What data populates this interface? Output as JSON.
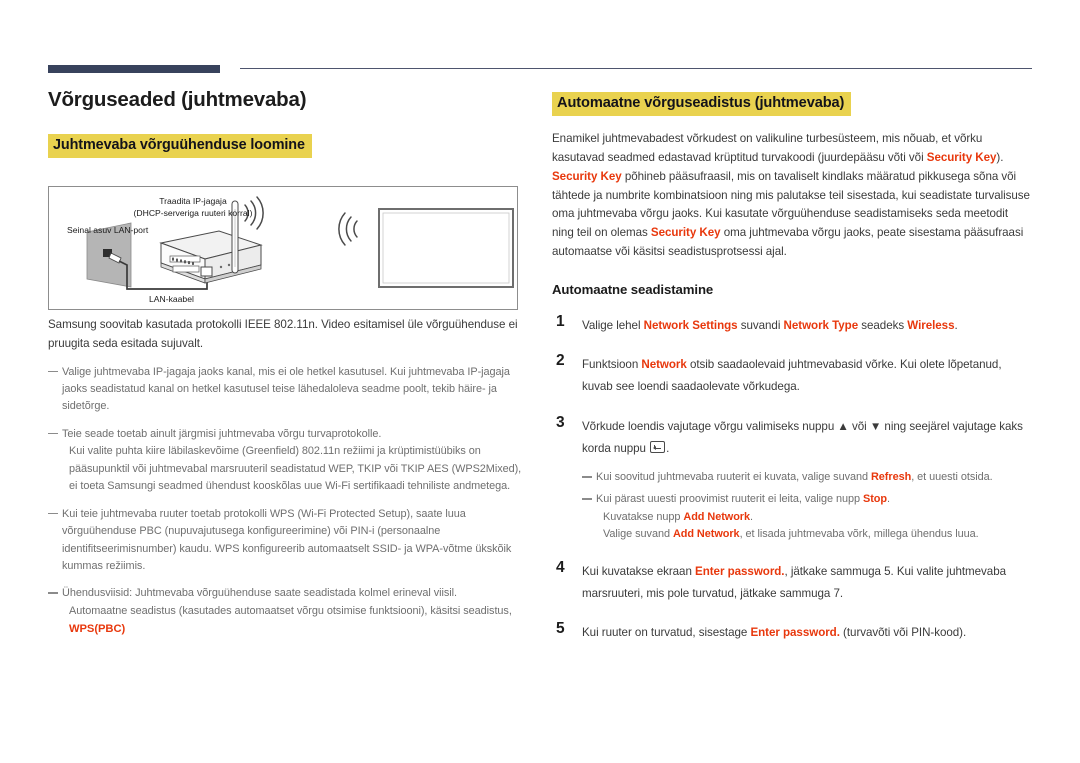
{
  "theme": {
    "navy_rule": "#38425c",
    "highlight_yellow": "#e9d24f",
    "accent_red": "#e8380d",
    "body_text": "#3b3b3b",
    "muted_text": "#6f6f6f"
  },
  "left": {
    "title": "Võrguseaded (juhtmevaba)",
    "section_heading": "Juhtmevaba võrguühenduse loomine",
    "diagram": {
      "labels": {
        "router_line1": "Traadita IP-jagaja",
        "router_line2": "(DHCP-serveriga ruuteri korral)",
        "wall_port": "Seinal asuv LAN-port",
        "lan_cable": "LAN-kaabel"
      }
    },
    "intro": "Samsung soovitab kasutada protokolli IEEE 802.11n. Video esitamisel üle võrguühenduse ei pruugita seda esitada sujuvalt.",
    "notes": [
      {
        "main": "Valige juhtmevaba IP-jagaja jaoks kanal, mis ei ole hetkel kasutusel. Kui juhtmevaba IP-jagaja jaoks seadistatud kanal on hetkel kasutusel teise lähedaloleva seadme poolt, tekib häire- ja sidetõrge.",
        "cont": []
      },
      {
        "main": "Teie seade toetab ainult järgmisi juhtmevaba võrgu turvaprotokolle.",
        "cont": [
          "Kui valite puhta kiire läbilaskevõime (Greenfield) 802.11n režiimi ja krüptimistüübiks on pääsupunktil või juhtmevabal marsruuteril seadistatud WEP, TKIP või TKIP AES (WPS2Mixed), ei toeta Samsungi seadmed ühendust kooskõlas uue Wi-Fi sertifikaadi tehniliste andmetega."
        ]
      },
      {
        "main": "Kui teie juhtmevaba ruuter toetab protokolli WPS (Wi-Fi Protected Setup), saate luua võrguühenduse PBC (nupuvajutusega konfigureerimine) või PIN-i (personaalne identifitseerimisnumber) kaudu. WPS konfigureerib automaatselt SSID- ja WPA-võtme ükskõik kummas režiimis.",
        "cont": []
      },
      {
        "main": "Ühendusviisid: Juhtmevaba võrguühenduse saate seadistada kolmel erineval viisil.",
        "cont": [
          "Automaatne seadistus (kasutades automaatset võrgu otsimise funktsiooni), käsitsi seadistus,"
        ],
        "tag": "WPS(PBC)"
      }
    ]
  },
  "right": {
    "section_heading": "Automaatne võrguseadistus (juhtmevaba)",
    "intro": {
      "p1": "Enamikel juhtmevabadest võrkudest on valikuline turbesüsteem, mis nõuab, et võrku kasutavad seadmed edastavad krüptitud turvakoodi (juurdepääsu võti või ",
      "k1": "Security Key",
      "p2": "). ",
      "k2": "Security Key",
      "p3": " põhineb pääsufraasil, mis on tavaliselt kindlaks määratud pikkusega sõna või tähtede ja numbrite kombinatsioon ning mis palutakse teil sisestada, kui seadistate turvalisuse oma juhtmevaba võrgu jaoks. Kui kasutate võrguühenduse seadistamiseks seda meetodit ning teil on olemas ",
      "k3": "Security Key",
      "p4": " oma juhtmevaba võrgu jaoks, peate sisestama pääsufraasi automaatse või käsitsi seadistusprotsessi ajal."
    },
    "sub_heading": "Automaatne seadistamine",
    "steps": [
      {
        "num": "1",
        "parts": [
          {
            "t": "Valige lehel ",
            "b": false
          },
          {
            "t": "Network Settings",
            "b": true
          },
          {
            "t": " suvandi ",
            "b": false
          },
          {
            "t": "Network Type",
            "b": true
          },
          {
            "t": " seadeks ",
            "b": false
          },
          {
            "t": "Wireless",
            "b": true
          },
          {
            "t": ".",
            "b": false
          }
        ]
      },
      {
        "num": "2",
        "parts": [
          {
            "t": "Funktsioon ",
            "b": false
          },
          {
            "t": "Network",
            "b": true
          },
          {
            "t": " otsib saadaolevaid juhtmevabasid võrke. Kui olete lõpetanud, kuvab see loendi saadaolevate võrkudega.",
            "b": false
          }
        ]
      },
      {
        "num": "3",
        "parts": [
          {
            "t": "Võrkude loendis vajutage võrgu valimiseks nuppu ▲ või ▼ ning seejärel vajutage kaks korda nuppu ",
            "b": false
          }
        ],
        "enter_key": true,
        "after_key": ".",
        "notes": [
          {
            "parts": [
              {
                "t": "Kui soovitud juhtmevaba ruuterit ei kuvata, valige suvand ",
                "b": false
              },
              {
                "t": "Refresh",
                "b": true
              },
              {
                "t": ", et uuesti otsida.",
                "b": false
              }
            ],
            "cont": []
          },
          {
            "parts": [
              {
                "t": "Kui pärast uuesti proovimist ruuterit ei leita, valige nupp ",
                "b": false
              },
              {
                "t": "Stop",
                "b": true
              },
              {
                "t": ".",
                "b": false
              }
            ],
            "cont": [
              [
                {
                  "t": "Kuvatakse nupp ",
                  "b": false
                },
                {
                  "t": "Add Network",
                  "b": true
                },
                {
                  "t": ".",
                  "b": false
                }
              ],
              [
                {
                  "t": "Valige suvand ",
                  "b": false
                },
                {
                  "t": "Add Network",
                  "b": true
                },
                {
                  "t": ", et lisada juhtmevaba võrk, millega ühendus luua.",
                  "b": false
                }
              ]
            ]
          }
        ]
      },
      {
        "num": "4",
        "parts": [
          {
            "t": "Kui kuvatakse ekraan ",
            "b": false
          },
          {
            "t": "Enter password.",
            "b": true
          },
          {
            "t": ", jätkake sammuga 5. Kui valite juhtmevaba marsruuteri, mis pole turvatud, jätkake sammuga 7.",
            "b": false
          }
        ]
      },
      {
        "num": "5",
        "parts": [
          {
            "t": "Kui ruuter on turvatud, sisestage ",
            "b": false
          },
          {
            "t": "Enter password.",
            "b": true
          },
          {
            "t": " (turvavõti või PIN-kood).",
            "b": false
          }
        ]
      }
    ]
  }
}
